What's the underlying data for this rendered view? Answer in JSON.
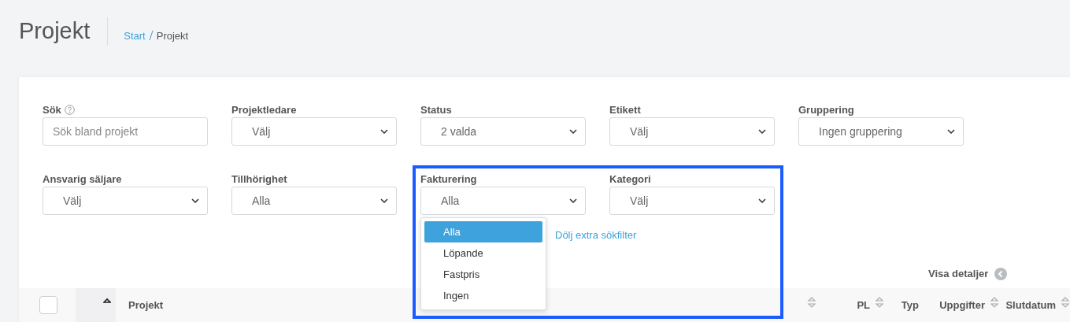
{
  "header": {
    "title": "Projekt",
    "breadcrumb": [
      {
        "label": "Start",
        "link": true
      },
      {
        "label": "Projekt",
        "link": false
      }
    ]
  },
  "filter_rows": [
    [
      {
        "label": "Sök",
        "kind": "text",
        "help": true,
        "placeholder": "Sök bland projekt"
      },
      {
        "label": "Projektledare",
        "kind": "select",
        "value": "Välj"
      },
      {
        "label": "Status",
        "kind": "select",
        "value": "2 valda"
      },
      {
        "label": "Etikett",
        "kind": "select",
        "value": "Välj"
      },
      {
        "label": "Gruppering",
        "kind": "select",
        "value": "Ingen gruppering"
      }
    ],
    [
      {
        "label": "Ansvarig säljare",
        "kind": "select",
        "value": "Välj"
      },
      {
        "label": "Tillhörighet",
        "kind": "select",
        "value": "Alla"
      },
      {
        "label": "Fakturering",
        "kind": "select",
        "value": "Alla",
        "expanded": true,
        "options": [
          {
            "label": "Alla",
            "selected": true
          },
          {
            "label": "Löpande",
            "selected": false
          },
          {
            "label": "Fastpris",
            "selected": false
          },
          {
            "label": "Ingen",
            "selected": false
          }
        ]
      },
      {
        "label": "Kategori",
        "kind": "select",
        "value": "Välj"
      }
    ]
  ],
  "hide_filters_link": "Dölj extra sökfilter",
  "details_toggle": "Visa detaljer",
  "table": {
    "select_all_checked": false,
    "sorted_ascending": true,
    "columns": [
      {
        "label": "Projekt",
        "sortable": false
      },
      {
        "sortable": true
      },
      {
        "label": "PL",
        "sortable": true
      },
      {
        "label": "Typ",
        "sortable": false
      },
      {
        "label": "Uppgifter",
        "sortable": true
      },
      {
        "label": "Slutdatum",
        "sortable": true
      }
    ]
  }
}
